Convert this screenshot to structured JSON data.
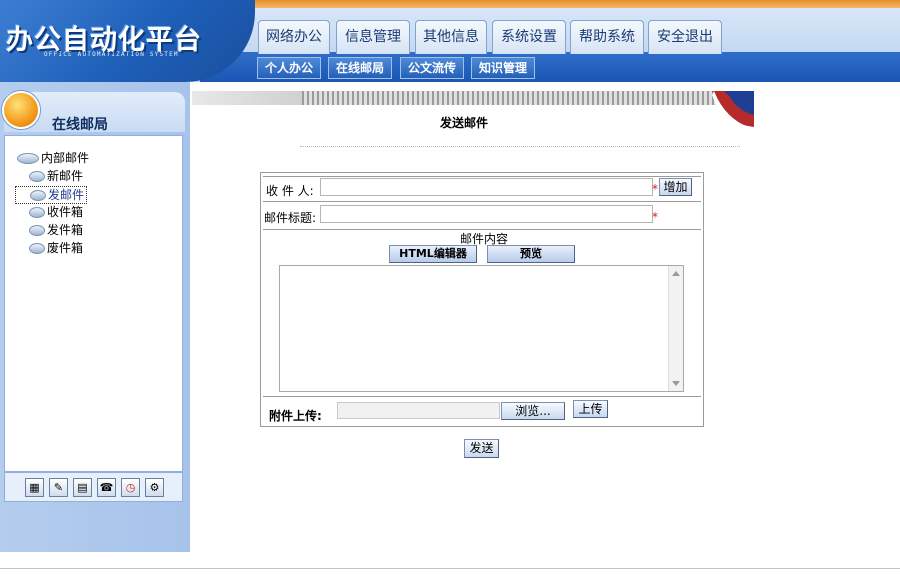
{
  "logo": {
    "title": "办公自动化平台",
    "subtitle": "OFFICE AUTOMATIZATION SYSTEM"
  },
  "main_nav": [
    "网络办公",
    "信息管理",
    "其他信息",
    "系统设置",
    "帮助系统",
    "安全退出"
  ],
  "sub_nav": [
    "个人办公",
    "在线邮局",
    "公文流传",
    "知识管理"
  ],
  "sidebar": {
    "title": "在线邮局",
    "root": "内部邮件",
    "items": [
      "新邮件",
      "发邮件",
      "收件箱",
      "发件箱",
      "废件箱"
    ],
    "selected_item": "发邮件",
    "tools": [
      "calendar-icon",
      "edit-icon",
      "document-icon",
      "phone-icon",
      "clock-icon",
      "tools-icon"
    ]
  },
  "page": {
    "title": "发送邮件"
  },
  "form": {
    "recipient_label": "收 件 人:",
    "recipient_value": "",
    "add_button": "增加",
    "subject_label": "邮件标题:",
    "subject_value": "",
    "content_label": "邮件内容",
    "html_editor_button": "HTML编辑器",
    "preview_button": "预览",
    "body_value": "",
    "attachment_label": "附件上传:",
    "browse_button": "浏览...",
    "upload_button": "上传",
    "required_mark": "*"
  },
  "send_button": "发送",
  "colors": {
    "header_blue": "#1e5fb8",
    "accent_orange": "#f39a1a",
    "required_red": "#d21b1b",
    "sidebar_blue": "#b4cdee"
  }
}
